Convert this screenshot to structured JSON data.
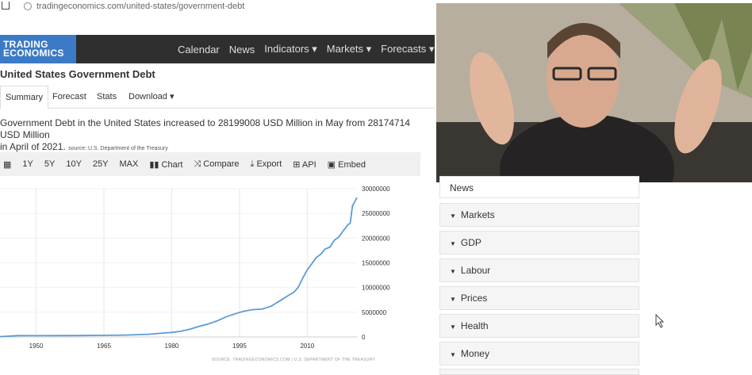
{
  "browser": {
    "url": "tradingeconomics.com/united-states/government-debt"
  },
  "header": {
    "logo_line1": "TRADING",
    "logo_line2": "ECONOMICS",
    "nav": [
      "Calendar",
      "News",
      "Indicators ▾",
      "Markets ▾",
      "Forecasts ▾"
    ]
  },
  "page": {
    "title": "United States Government Debt",
    "tabs": [
      "Summary",
      "Forecast",
      "Stats",
      "Download ▾"
    ],
    "description_line1": "Government Debt in the United States increased to 28199008 USD Million in May from 28174714 USD Million",
    "description_line2": "in April of 2021.",
    "source": "source: U.S. Department of the Treasury"
  },
  "toolbar": {
    "items": [
      "1Y",
      "5Y",
      "10Y",
      "25Y",
      "MAX",
      "Chart",
      "Compare",
      "Export",
      "API",
      "Embed"
    ]
  },
  "chart_data": {
    "type": "line",
    "x_ticks": [
      "1950",
      "1965",
      "1980",
      "1995",
      "2010"
    ],
    "y_ticks": [
      "30000000",
      "25000000",
      "20000000",
      "15000000",
      "10000000",
      "5000000",
      "0"
    ],
    "ylim": [
      0,
      30000000
    ],
    "xlim": [
      1942,
      2021
    ],
    "line_color": "#5b9bd5",
    "footer": "SOURCE: TRADINGECONOMICS.COM | U.S. DEPARTMENT OF THE TREASURY",
    "series": [
      {
        "x": [
          1942,
          1946,
          1950,
          1955,
          1960,
          1965,
          1970,
          1975,
          1978,
          1980,
          1982,
          1984,
          1986,
          1988,
          1990,
          1992,
          1994,
          1996,
          1998,
          2000,
          2002,
          2004,
          2006,
          2007,
          2008,
          2009,
          2010,
          2011,
          2012,
          2013,
          2014,
          2015,
          2016,
          2017,
          2018,
          2019,
          2019.5,
          2020,
          2020.3,
          2021
        ],
        "y": [
          72000,
          270000,
          257000,
          274000,
          290000,
          320000,
          380000,
          540000,
          780000,
          910000,
          1140000,
          1570000,
          2120000,
          2600000,
          3230000,
          4060000,
          4690000,
          5220000,
          5530000,
          5630000,
          6230000,
          7350000,
          8500000,
          9010000,
          10030000,
          11910000,
          13560000,
          14790000,
          16070000,
          16740000,
          17820000,
          18150000,
          19570000,
          20240000,
          21520000,
          22720000,
          23000000,
          26500000,
          27000000,
          28199008
        ]
      }
    ]
  },
  "sidebar": {
    "partial_label": "News",
    "items": [
      "Markets",
      "GDP",
      "Labour",
      "Prices",
      "Health",
      "Money"
    ]
  }
}
